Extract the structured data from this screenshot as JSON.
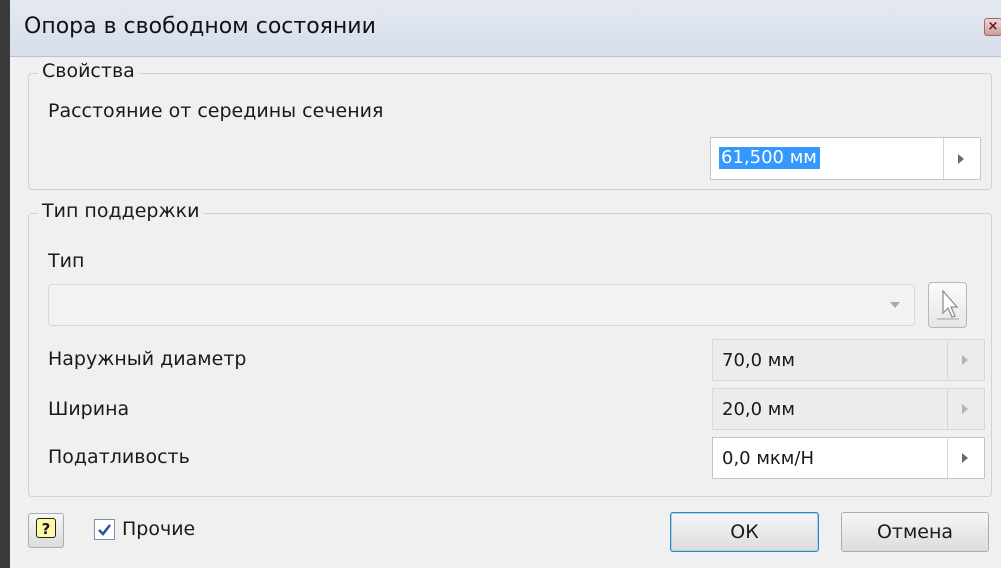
{
  "window": {
    "title": "Опора в свободном состоянии"
  },
  "properties": {
    "group_label": "Свойства",
    "distance_label": "Расстояние от середины сечения",
    "distance_value": "61,500 мм"
  },
  "support": {
    "group_label": "Тип поддержки",
    "type_label": "Тип",
    "type_value": "",
    "outer_diameter_label": "Наружный диаметр",
    "outer_diameter_value": "70,0 мм",
    "width_label": "Ширина",
    "width_value": "20,0 мм",
    "compliance_label": "Податливость",
    "compliance_value": "0,0 мкм/Н"
  },
  "footer": {
    "help_glyph": "?",
    "other_label": "Прочие",
    "other_checked": true,
    "ok_label": "ОК",
    "cancel_label": "Отмена"
  },
  "colors": {
    "selection": "#3399ff",
    "accent": "#3c7fb1"
  },
  "icons": {
    "close": "close-icon",
    "select": "cursor-select-icon",
    "help": "help-icon",
    "check": "checkmark-icon"
  }
}
